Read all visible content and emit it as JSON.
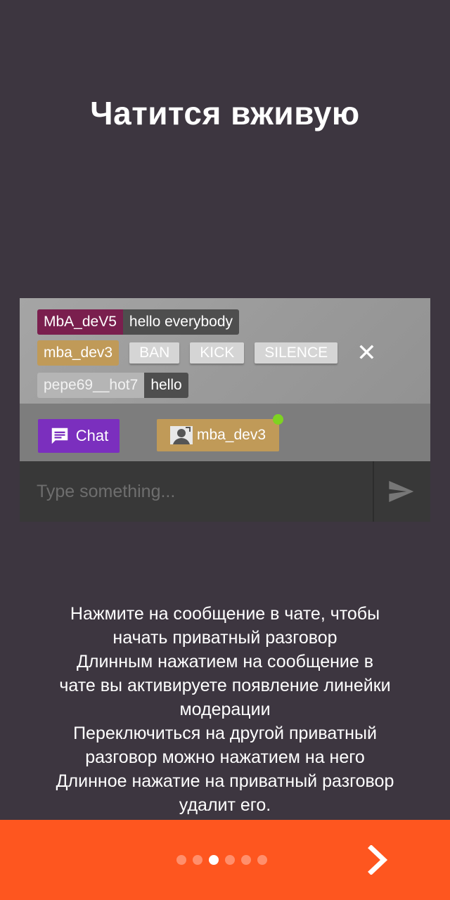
{
  "title": "Чатится вживую",
  "preview": {
    "messages": [
      {
        "user": "MbA_deV5",
        "text": "hello everybody"
      },
      {
        "user": "mba_dev3"
      },
      {
        "user": "pepe69__hot7",
        "text": "hello"
      }
    ],
    "moderation": {
      "ban": "BAN",
      "kick": "KICK",
      "silence": "SILENCE",
      "close": "✕"
    },
    "tabs": {
      "chat": "Chat",
      "user": "mba_dev3"
    },
    "input": {
      "placeholder": "Type something..."
    }
  },
  "description": [
    "Нажмите на сообщение в чате, чтобы",
    "начать приватный разговор",
    "Длинным нажатием на сообщение в",
    "чате вы активируете появление линейки",
    "модерации",
    "Переключиться на другой приватный",
    "разговор можно нажатием на него",
    "Длинное нажатие на приватный разговор",
    "удалит его."
  ],
  "pagination": {
    "total": 6,
    "active": 3
  },
  "colors": {
    "background": "#3d3640",
    "footer": "#fe561f",
    "chat_tab": "#7b2fbe",
    "user_tab": "#c09a58",
    "online": "#7ed321"
  }
}
